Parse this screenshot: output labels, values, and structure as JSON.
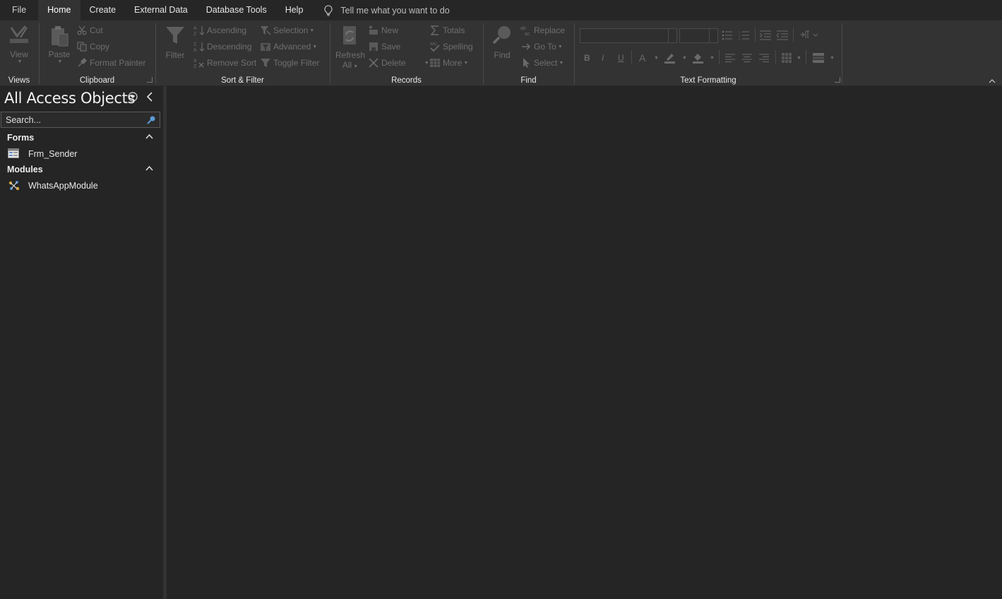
{
  "tabs": [
    {
      "label": "File"
    },
    {
      "label": "Home"
    },
    {
      "label": "Create"
    },
    {
      "label": "External Data"
    },
    {
      "label": "Database Tools"
    },
    {
      "label": "Help"
    }
  ],
  "active_tab": "Home",
  "tell_me": {
    "placeholder": "Tell me what you want to do",
    "icon": "lightbulb-icon"
  },
  "ribbon": {
    "views": {
      "label": "Views",
      "view": "View"
    },
    "clipboard": {
      "label": "Clipboard",
      "paste": "Paste",
      "cut": "Cut",
      "copy": "Copy",
      "format_painter": "Format Painter"
    },
    "sort_filter": {
      "label": "Sort & Filter",
      "filter": "Filter",
      "ascending": "Ascending",
      "descending": "Descending",
      "remove_sort": "Remove Sort",
      "selection": "Selection",
      "advanced": "Advanced",
      "toggle_filter": "Toggle Filter"
    },
    "records": {
      "label": "Records",
      "refresh": "Refresh",
      "refresh_all": "All",
      "new": "New",
      "save": "Save",
      "delete": "Delete",
      "totals": "Totals",
      "spelling": "Spelling",
      "more": "More"
    },
    "find": {
      "label": "Find",
      "find": "Find",
      "replace": "Replace",
      "goto": "Go To",
      "select": "Select"
    },
    "text_formatting": {
      "label": "Text Formatting",
      "bold": "B",
      "italic": "I",
      "underline": "U",
      "font_color": "A"
    }
  },
  "colors": {
    "background": "#252525",
    "ribbon": "#333333",
    "disabled_text": "#6f6f6f",
    "text": "#e6e6e6"
  },
  "nav": {
    "title": "All Access Objects",
    "search_placeholder": "Search...",
    "categories": [
      {
        "label": "Forms",
        "items": [
          {
            "label": "Frm_Sender",
            "icon": "form-icon"
          }
        ]
      },
      {
        "label": "Modules",
        "items": [
          {
            "label": "WhatsAppModule",
            "icon": "module-icon"
          }
        ]
      }
    ]
  }
}
